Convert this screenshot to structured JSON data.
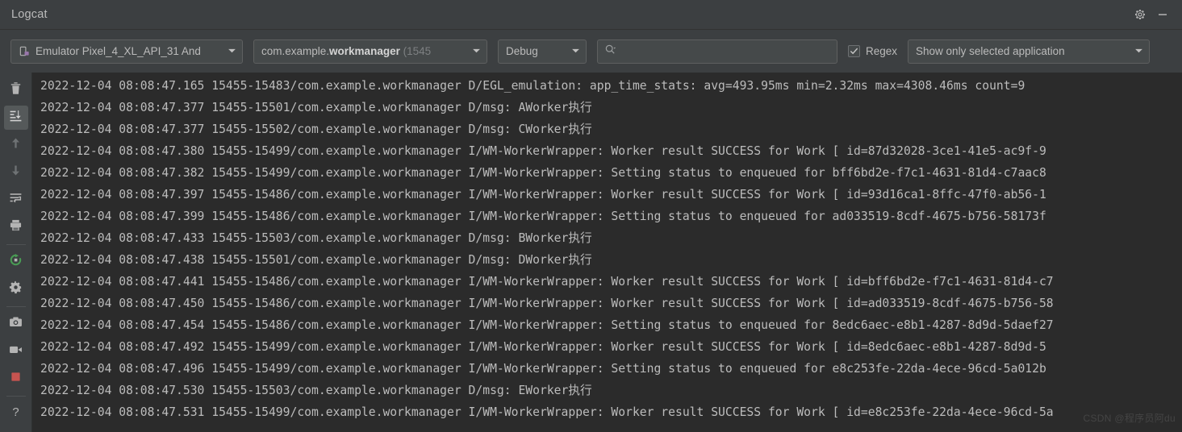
{
  "window": {
    "title": "Logcat",
    "gear_icon": "gear-icon",
    "minimize_icon": "minimize-icon"
  },
  "toolbar": {
    "device": {
      "icon": "device-phone-icon",
      "label": "Emulator Pixel_4_XL_API_31 And",
      "caret": "chevron-down-icon"
    },
    "process": {
      "prefix": "com.example.",
      "bold": "workmanager",
      "pid": " (1545",
      "caret": "chevron-down-icon"
    },
    "log_level": {
      "label": "Debug",
      "caret": "chevron-down-icon"
    },
    "search": {
      "icon": "search-icon",
      "value": "",
      "placeholder": ""
    },
    "regex": {
      "label": "Regex",
      "checked": true,
      "check_icon": "check-icon"
    },
    "filter": {
      "label": "Show only selected application",
      "caret": "chevron-down-icon"
    }
  },
  "sidebar": {
    "items": [
      {
        "name": "clear-logcat-button",
        "icon": "trash-icon",
        "active": false
      },
      {
        "name": "scroll-to-end-button",
        "icon": "scroll-to-end-icon",
        "active": true
      },
      {
        "name": "up-button",
        "icon": "arrow-up-icon",
        "active": false
      },
      {
        "name": "down-button",
        "icon": "arrow-down-icon",
        "active": false
      },
      {
        "name": "soft-wrap-button",
        "icon": "soft-wrap-icon",
        "active": false
      },
      {
        "name": "print-button",
        "icon": "print-icon",
        "active": false
      },
      {
        "name": "restart-button",
        "icon": "restart-icon",
        "active": false
      },
      {
        "name": "settings-button",
        "icon": "gear-icon",
        "active": false
      },
      {
        "name": "screenshot-button",
        "icon": "camera-icon",
        "active": false
      },
      {
        "name": "screen-record-button",
        "icon": "video-camera-icon",
        "active": false
      },
      {
        "name": "stop-button",
        "icon": "stop-square-icon",
        "active": false
      },
      {
        "name": "help-button",
        "icon": "question-mark-icon",
        "active": false
      }
    ]
  },
  "log": {
    "lines": [
      "2022-12-04 08:08:47.165 15455-15483/com.example.workmanager D/EGL_emulation: app_time_stats: avg=493.95ms min=2.32ms max=4308.46ms count=9",
      "2022-12-04 08:08:47.377 15455-15501/com.example.workmanager D/msg: AWorker执行",
      "2022-12-04 08:08:47.377 15455-15502/com.example.workmanager D/msg: CWorker执行",
      "2022-12-04 08:08:47.380 15455-15499/com.example.workmanager I/WM-WorkerWrapper: Worker result SUCCESS for Work [ id=87d32028-3ce1-41e5-ac9f-9",
      "2022-12-04 08:08:47.382 15455-15499/com.example.workmanager I/WM-WorkerWrapper: Setting status to enqueued for bff6bd2e-f7c1-4631-81d4-c7aac8",
      "2022-12-04 08:08:47.397 15455-15486/com.example.workmanager I/WM-WorkerWrapper: Worker result SUCCESS for Work [ id=93d16ca1-8ffc-47f0-ab56-1",
      "2022-12-04 08:08:47.399 15455-15486/com.example.workmanager I/WM-WorkerWrapper: Setting status to enqueued for ad033519-8cdf-4675-b756-58173f",
      "2022-12-04 08:08:47.433 15455-15503/com.example.workmanager D/msg: BWorker执行",
      "2022-12-04 08:08:47.438 15455-15501/com.example.workmanager D/msg: DWorker执行",
      "2022-12-04 08:08:47.441 15455-15486/com.example.workmanager I/WM-WorkerWrapper: Worker result SUCCESS for Work [ id=bff6bd2e-f7c1-4631-81d4-c7",
      "2022-12-04 08:08:47.450 15455-15486/com.example.workmanager I/WM-WorkerWrapper: Worker result SUCCESS for Work [ id=ad033519-8cdf-4675-b756-58",
      "2022-12-04 08:08:47.454 15455-15486/com.example.workmanager I/WM-WorkerWrapper: Setting status to enqueued for 8edc6aec-e8b1-4287-8d9d-5daef27",
      "2022-12-04 08:08:47.492 15455-15499/com.example.workmanager I/WM-WorkerWrapper: Worker result SUCCESS for Work [ id=8edc6aec-e8b1-4287-8d9d-5",
      "2022-12-04 08:08:47.496 15455-15499/com.example.workmanager I/WM-WorkerWrapper: Setting status to enqueued for e8c253fe-22da-4ece-96cd-5a012b",
      "2022-12-04 08:08:47.530 15455-15503/com.example.workmanager D/msg: EWorker执行",
      "2022-12-04 08:08:47.531 15455-15499/com.example.workmanager I/WM-WorkerWrapper: Worker result SUCCESS for Work [ id=e8c253fe-22da-4ece-96cd-5a"
    ],
    "watermark": "CSDN @程序员阿du"
  },
  "colors": {
    "chrome_bg": "#3c3f41",
    "log_bg": "#2b2b2b",
    "text": "#bcbcbc",
    "accent_green": "#499c54",
    "accent_red": "#c75450",
    "accent_purple": "#9876aa"
  }
}
